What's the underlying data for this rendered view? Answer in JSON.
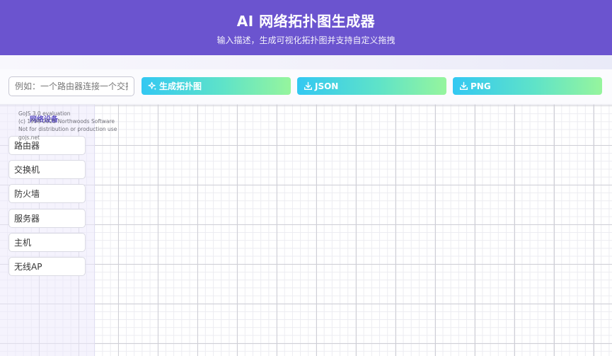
{
  "header": {
    "title": "AI 网络拓扑图生成器",
    "subtitle": "输入描述，生成可视化拓扑图并支持自定义拖拽"
  },
  "toolbar": {
    "prompt_placeholder": "例如：一个路由器连接一个交换机",
    "generate_label": "生成拓扑图",
    "json_label": "JSON",
    "png_label": "PNG",
    "icons": {
      "generate": "sparkle-icon",
      "json": "download-icon",
      "png": "download-icon"
    }
  },
  "palette": {
    "title": "网络设备",
    "items": [
      {
        "label": "路由器"
      },
      {
        "label": "交换机"
      },
      {
        "label": "防火墙"
      },
      {
        "label": "服务器"
      },
      {
        "label": "主机"
      },
      {
        "label": "无线AP"
      }
    ]
  },
  "watermark": {
    "lines": [
      "GoJS 3.0 evaluation",
      "(c) 1998-2025 Northwoods Software",
      "Not for distribution or production use",
      "gojs.net"
    ]
  },
  "colors": {
    "header_bg": "#6b54cf",
    "button_gradient_start": "#33c8f2",
    "button_gradient_end": "#96f59d",
    "palette_title": "#5a4cc2"
  }
}
